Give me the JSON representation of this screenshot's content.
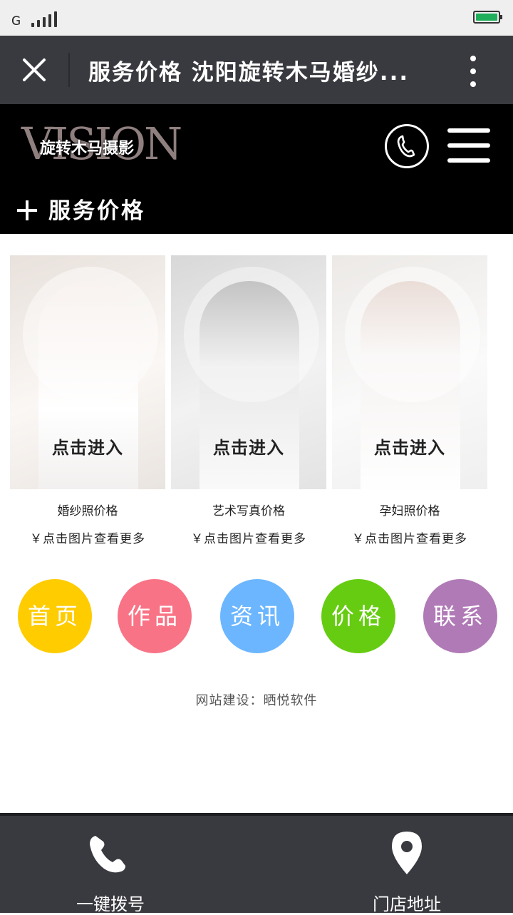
{
  "status_bar": {
    "carrier": "G",
    "signal_bars": 5,
    "battery_color": "#1fae5a"
  },
  "title_bar": {
    "title": "服务价格 沈阳旋转木马婚纱...",
    "close_icon": "close-icon",
    "more_icon": "more-vertical-icon"
  },
  "header": {
    "logo_text": "VISION",
    "logo_cn": "旋转木马摄影",
    "phone_icon": "phone-icon",
    "menu_icon": "hamburger-menu-icon",
    "section_title": "服务价格"
  },
  "cards": [
    {
      "enter": "点击进入",
      "name": "婚纱照价格",
      "more": "￥点击图片查看更多"
    },
    {
      "enter": "点击进入",
      "name": "艺术写真价格",
      "more": "￥点击图片查看更多"
    },
    {
      "enter": "点击进入",
      "name": "孕妇照价格",
      "more": "￥点击图片查看更多"
    }
  ],
  "nav": [
    {
      "label": "首页",
      "color": "#ffcc00"
    },
    {
      "label": "作品",
      "color": "#f87386"
    },
    {
      "label": "资讯",
      "color": "#6bb6ff"
    },
    {
      "label": "价格",
      "color": "#66cc11"
    },
    {
      "label": "联系",
      "color": "#b07ab6"
    }
  ],
  "footer": {
    "credit": "网站建设：晒悦软件"
  },
  "bottom_bar": {
    "dial_label": "一键拨号",
    "address_label": "门店地址"
  }
}
